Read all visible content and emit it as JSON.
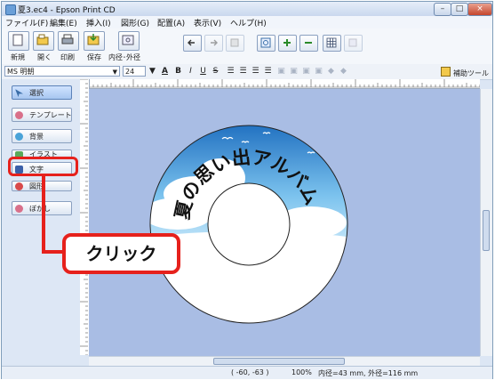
{
  "window": {
    "title": "夏3.ec4 - Epson Print CD",
    "minimize": "–",
    "maximize": "□",
    "close": "×"
  },
  "menu": [
    "ファイル(F)",
    "編集(E)",
    "挿入(I)",
    "図形(G)",
    "配置(A)",
    "表示(V)",
    "ヘルプ(H)"
  ],
  "toolbar": {
    "new": "新規",
    "open": "開く",
    "print": "印刷",
    "save": "保存",
    "diameter": "内径･外径"
  },
  "fontbar": {
    "font": "MS 明朝",
    "size": "24",
    "bold": "B",
    "italic": "I",
    "underline": "U",
    "strike": "S",
    "helper_tool": "補助ツール"
  },
  "sidebar": [
    {
      "label": "選択"
    },
    {
      "label": "テンプレート"
    },
    {
      "label": "背景"
    },
    {
      "label": "イラスト"
    },
    {
      "label": "文字"
    },
    {
      "label": "図形"
    },
    {
      "label": "ぼかし"
    }
  ],
  "canvas": {
    "arc_text": "夏の思い出アルバム"
  },
  "status": {
    "coords": "( -60, -63 )",
    "zoom": "100%",
    "disc_size": "内径=43 mm, 外径=116 mm"
  },
  "annotation": {
    "callout": "クリック"
  },
  "colors": {
    "accent": "#e6211c",
    "canvas": "#a9bde4",
    "sky_top": "#1f6fc0",
    "sky_bottom": "#bfe3f6"
  }
}
